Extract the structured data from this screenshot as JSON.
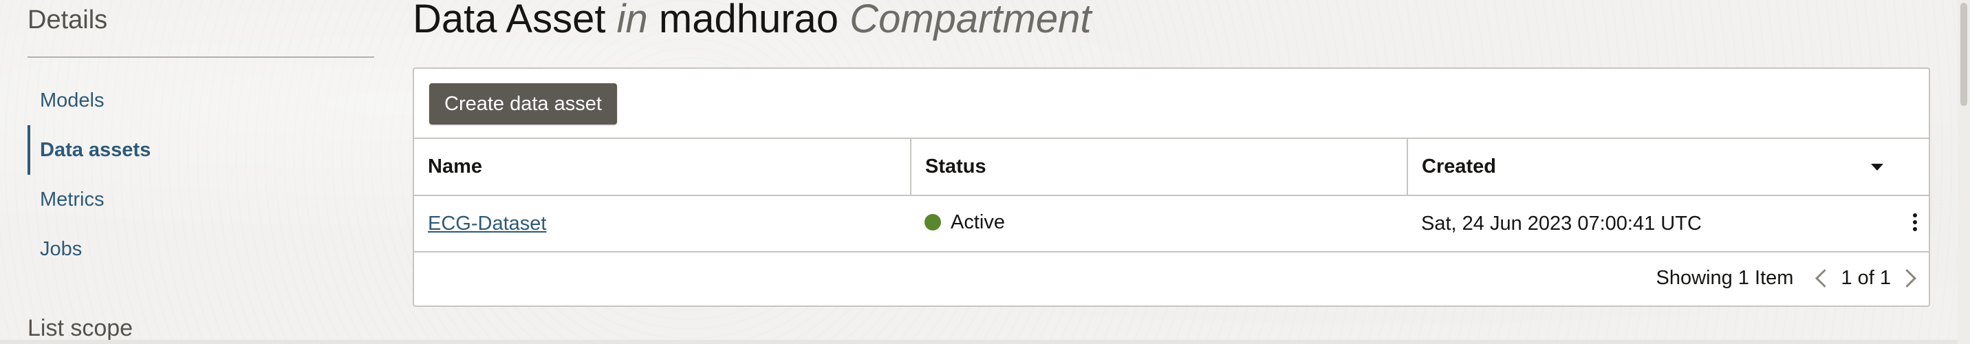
{
  "sidebar": {
    "heading": "Details",
    "items": [
      {
        "label": "Models",
        "active": false
      },
      {
        "label": "Data assets",
        "active": true
      },
      {
        "label": "Metrics",
        "active": false
      },
      {
        "label": "Jobs",
        "active": false
      }
    ],
    "list_scope_label": "List scope"
  },
  "header": {
    "resource_type": "Data Asset",
    "connector": "in",
    "compartment_name": "madhurao",
    "compartment_label": "Compartment"
  },
  "toolbar": {
    "create_label": "Create data asset"
  },
  "table": {
    "columns": [
      "Name",
      "Status",
      "Created"
    ],
    "sort_column": "Created",
    "rows": [
      {
        "name": "ECG-Dataset",
        "status": "Active",
        "created": "Sat, 24 Jun 2023 07:00:41 UTC"
      }
    ]
  },
  "pagination": {
    "showing": "Showing 1 Item",
    "page": "1 of 1"
  },
  "colors": {
    "link": "#2e5a78",
    "status_active": "#5a862e",
    "button_bg": "#5d5953"
  },
  "icons": {
    "sort": "chevron-down-icon",
    "row_actions": "kebab-menu-icon",
    "prev": "chevron-left-icon",
    "next": "chevron-right-icon"
  }
}
